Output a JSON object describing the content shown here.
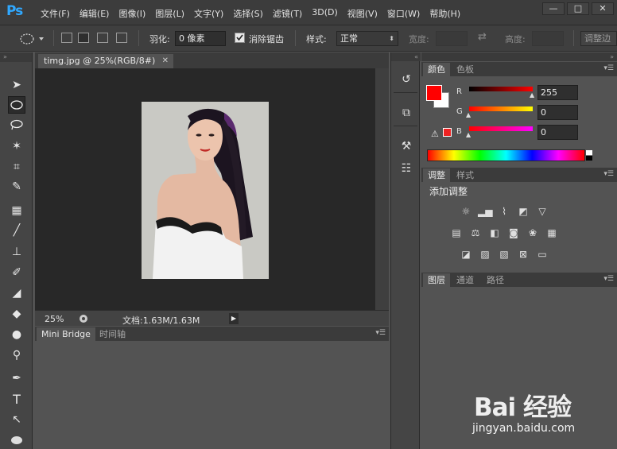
{
  "app": {
    "logo": "Ps"
  },
  "menu": [
    "文件(F)",
    "编辑(E)",
    "图像(I)",
    "图层(L)",
    "文字(Y)",
    "选择(S)",
    "滤镜(T)",
    "3D(D)",
    "视图(V)",
    "窗口(W)",
    "帮助(H)"
  ],
  "window_controls": {
    "minimize": "—",
    "maximize": "□",
    "close": "✕"
  },
  "options": {
    "feather_label": "羽化:",
    "feather_value": "0 像素",
    "antialias_label": "消除锯齿",
    "style_label": "样式:",
    "style_value": "正常",
    "width_label": "宽度:",
    "height_label": "高度:",
    "refine_button": "调整边"
  },
  "document": {
    "tab_title": "timg.jpg @ 25%(RGB/8#)",
    "zoom": "25%",
    "doc_size": "文档:1.63M/1.63M"
  },
  "bottom_panel": {
    "tabs": [
      "Mini Bridge",
      "时间轴"
    ]
  },
  "color_panel": {
    "tabs": [
      "颜色",
      "色板"
    ],
    "r_label": "R",
    "g_label": "G",
    "b_label": "B",
    "r_value": "255",
    "g_value": "0",
    "b_value": "0",
    "fg_color": "#ff0000",
    "bg_color": "#ffffff"
  },
  "adjust_panel": {
    "tabs": [
      "调整",
      "样式"
    ],
    "title": "添加调整",
    "icons_row1": [
      "brightness-icon",
      "levels-icon",
      "curves-icon",
      "exposure-icon",
      "gradient-triangle-icon"
    ],
    "icons_row2": [
      "vibrance-icon",
      "color-balance-icon",
      "black-white-icon",
      "photo-filter-icon",
      "channel-mixer-icon",
      "color-lookup-icon"
    ],
    "icons_row3": [
      "invert-icon",
      "posterize-icon",
      "threshold-icon",
      "selective-color-icon",
      "gradient-map-icon"
    ]
  },
  "layers_panel": {
    "tabs": [
      "图层",
      "通道",
      "路径"
    ]
  },
  "watermark": {
    "logo": "Bai 经验",
    "url": "jingyan.baidu.com"
  }
}
